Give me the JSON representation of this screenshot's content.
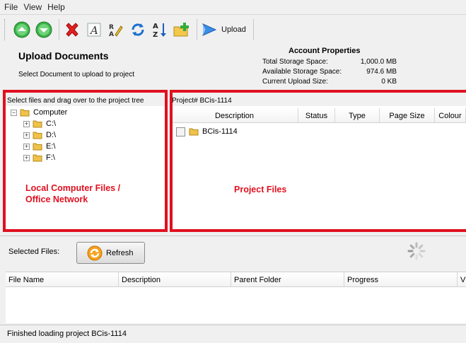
{
  "menu": [
    "File",
    "View",
    "Help"
  ],
  "toolbar": {
    "upload_label": "Upload",
    "icons": [
      "navigate-up-icon",
      "navigate-down-icon",
      "delete-icon",
      "rename-icon",
      "edit-icon",
      "refresh-icon",
      "sort-az-icon",
      "new-folder-icon",
      "upload-icon"
    ]
  },
  "header": {
    "title": "Upload Documents",
    "subtitle": "Select Document to upload to project"
  },
  "account": {
    "title": "Account Properties",
    "rows": [
      {
        "label": "Total Storage Space:",
        "value": "1,000.0 MB"
      },
      {
        "label": "Available Storage Space:",
        "value": "974.6 MB"
      },
      {
        "label": "Current Upload Size:",
        "value": "0 KB"
      }
    ]
  },
  "local_pane": {
    "header": "Select files and drag over to the project tree",
    "root": "Computer",
    "drives": [
      "C:\\",
      "D:\\",
      "E:\\",
      "F:\\"
    ],
    "annotation": "Local Computer Files / Office Network"
  },
  "project_pane": {
    "header": "Project# BCis-1114",
    "columns": [
      "Description",
      "Status",
      "Type",
      "Page Size",
      "Colour"
    ],
    "root": "BCis-1114",
    "annotation": "Project Files"
  },
  "selected": {
    "label": "Selected Files:",
    "refresh_label": "Refresh",
    "columns": [
      "File Name",
      "Description",
      "Parent Folder",
      "Progress",
      "V"
    ]
  },
  "status": "Finished loading project BCis-1114",
  "colors": {
    "annotation_red": "#e0101f"
  }
}
